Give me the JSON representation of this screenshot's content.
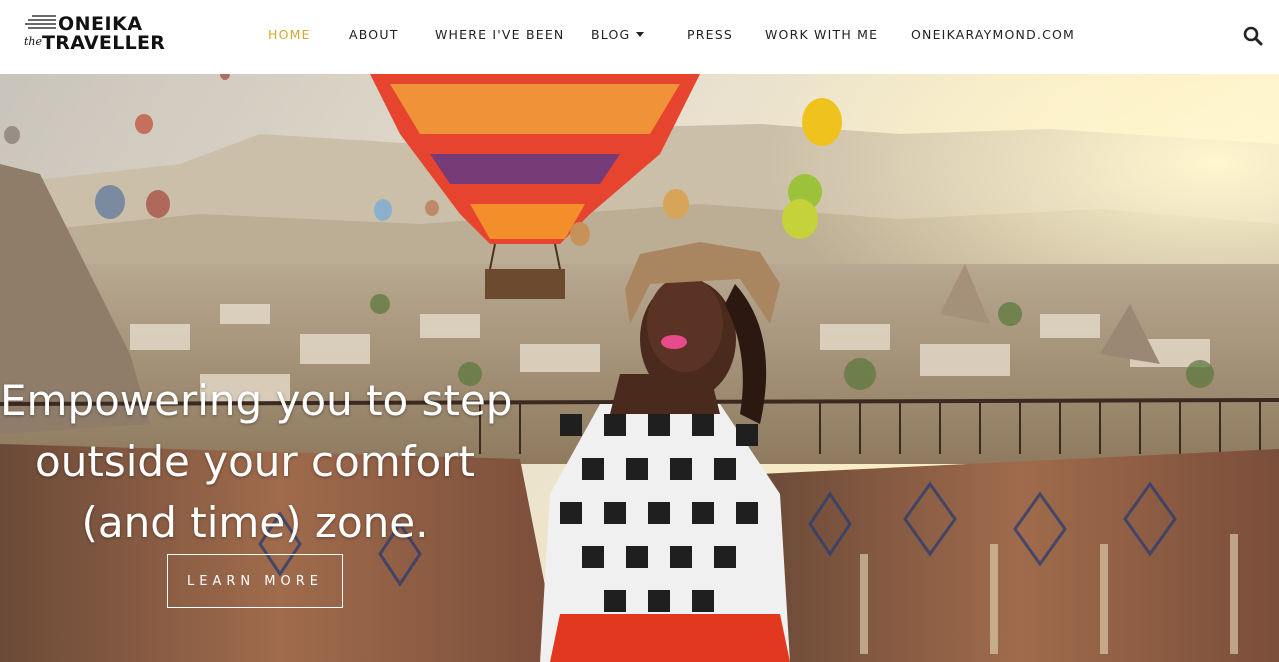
{
  "logo": {
    "top": "ONEIKA",
    "the": "the",
    "bottom": "TRAVELLER"
  },
  "nav": {
    "items": [
      {
        "label": "HOME",
        "active": true
      },
      {
        "label": "ABOUT"
      },
      {
        "label": "WHERE I'VE BEEN"
      },
      {
        "label": "BLOG",
        "has_dropdown": true
      },
      {
        "label": "PRESS"
      },
      {
        "label": "WORK WITH ME"
      },
      {
        "label": "ONEIKARAYMOND.COM"
      }
    ],
    "search_icon": "search-icon"
  },
  "hero": {
    "headline_lines": [
      "Empowering you to step",
      "outside your comfort",
      "(and time) zone."
    ],
    "cta_label": "LEARN MORE"
  },
  "colors": {
    "accent": "#d4a72c",
    "text": "#222222",
    "header_bg": "#ffffff"
  }
}
